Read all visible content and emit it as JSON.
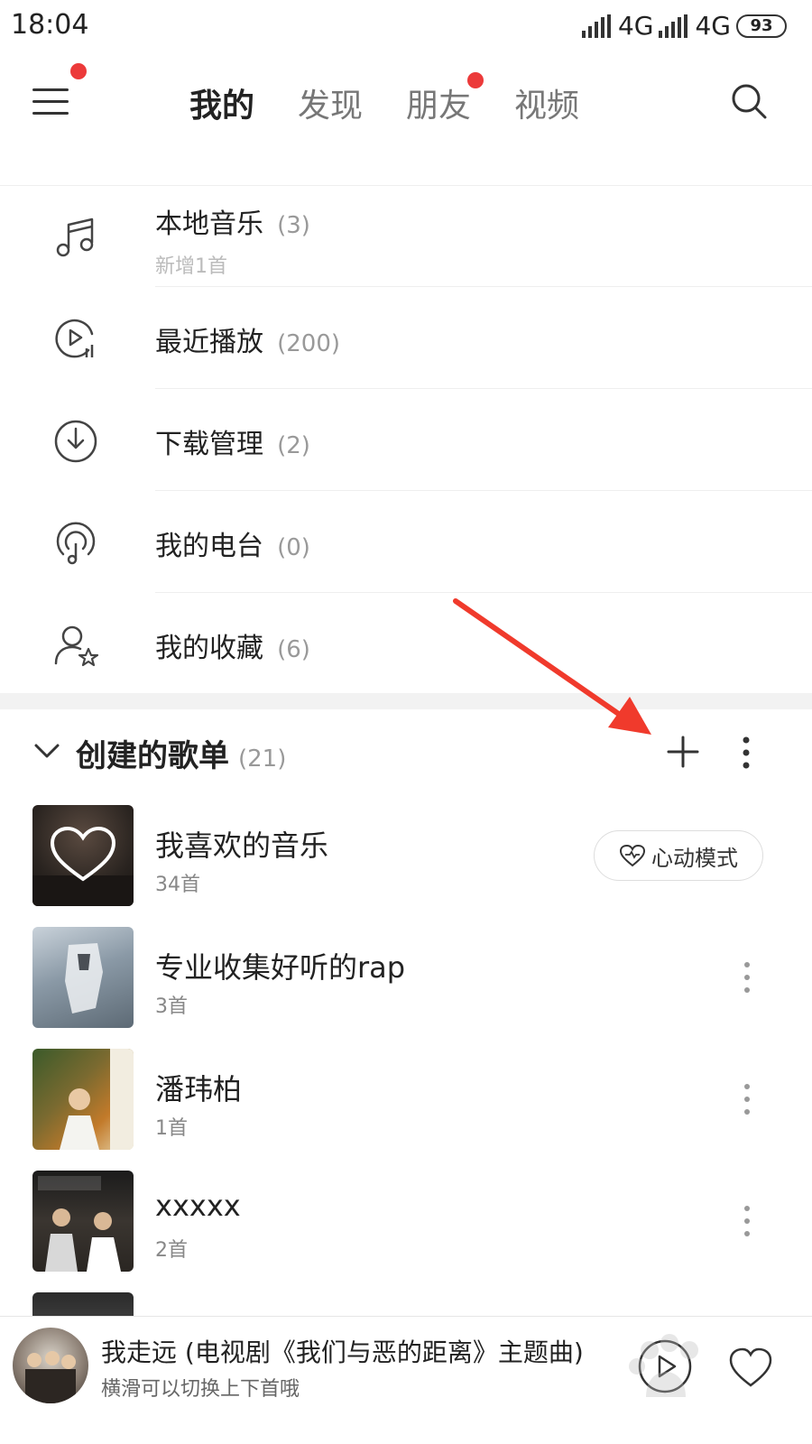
{
  "status_bar": {
    "time": "18:04",
    "network_1": "4G",
    "network_2": "4G",
    "battery": "93"
  },
  "top_nav": {
    "tabs": [
      {
        "label": "我的",
        "active": true
      },
      {
        "label": "发现",
        "active": false
      },
      {
        "label": "朋友",
        "active": false,
        "has_badge": true
      },
      {
        "label": "视频",
        "active": false
      }
    ],
    "menu_badge": true,
    "accent_color": "#ec3a3a"
  },
  "menu_items": [
    {
      "icon": "music-note-icon",
      "label": "本地音乐",
      "count": "(3)",
      "sub": "新增1首"
    },
    {
      "icon": "recent-play-icon",
      "label": "最近播放",
      "count": "(200)"
    },
    {
      "icon": "download-icon",
      "label": "下载管理",
      "count": "(2)"
    },
    {
      "icon": "radio-icon",
      "label": "我的电台",
      "count": "(0)"
    },
    {
      "icon": "favorite-user-icon",
      "label": "我的收藏",
      "count": "(6)"
    }
  ],
  "playlist_section": {
    "title": "创建的歌单",
    "count": "(21)"
  },
  "playlists": [
    {
      "name": "我喜欢的音乐",
      "sub": "34首",
      "action": "心动模式"
    },
    {
      "name": "专业收集好听的rap",
      "sub": "3首"
    },
    {
      "name": "潘玮柏",
      "sub": "1首"
    },
    {
      "name": "xxxxx",
      "sub": "2首"
    }
  ],
  "mini_player": {
    "title": "我走远 (电视剧《我们与恶的距离》主题曲)",
    "subtitle": "横滑可以切换上下首哦"
  }
}
